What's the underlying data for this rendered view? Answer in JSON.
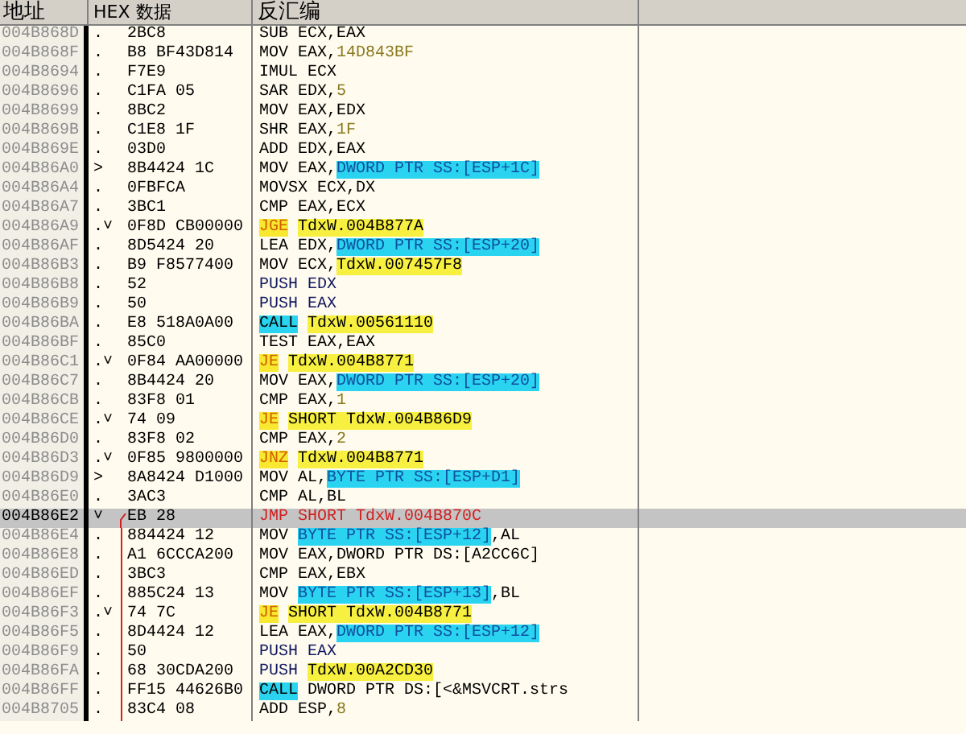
{
  "columns": {
    "address": "地址",
    "hex": "HEX 数据",
    "disassembly": "反汇编"
  },
  "rows": [
    {
      "address": "004B868D",
      "marker": ".",
      "hex": "2BC8",
      "segments": [
        {
          "text": "SUB ECX,EAX",
          "kind": "plain"
        }
      ],
      "selected": false,
      "jump_line": false
    },
    {
      "address": "004B868F",
      "marker": ".",
      "hex": "B8 BF43D814",
      "segments": [
        {
          "text": "MOV EAX,",
          "kind": "plain"
        },
        {
          "text": "14D843BF",
          "kind": "number"
        }
      ],
      "selected": false,
      "jump_line": false
    },
    {
      "address": "004B8694",
      "marker": ".",
      "hex": "F7E9",
      "segments": [
        {
          "text": "IMUL ECX",
          "kind": "plain"
        }
      ],
      "selected": false,
      "jump_line": false
    },
    {
      "address": "004B8696",
      "marker": ".",
      "hex": "C1FA 05",
      "segments": [
        {
          "text": "SAR EDX,",
          "kind": "plain"
        },
        {
          "text": "5",
          "kind": "number"
        }
      ],
      "selected": false,
      "jump_line": false
    },
    {
      "address": "004B8699",
      "marker": ".",
      "hex": "8BC2",
      "segments": [
        {
          "text": "MOV EAX,EDX",
          "kind": "plain"
        }
      ],
      "selected": false,
      "jump_line": false
    },
    {
      "address": "004B869B",
      "marker": ".",
      "hex": "C1E8 1F",
      "segments": [
        {
          "text": "SHR EAX,",
          "kind": "plain"
        },
        {
          "text": "1F",
          "kind": "number"
        }
      ],
      "selected": false,
      "jump_line": false
    },
    {
      "address": "004B869E",
      "marker": ".",
      "hex": "03D0",
      "segments": [
        {
          "text": "ADD EDX,EAX",
          "kind": "plain"
        }
      ],
      "selected": false,
      "jump_line": false
    },
    {
      "address": "004B86A0",
      "marker": ">",
      "hex": "8B4424 1C",
      "segments": [
        {
          "text": "MOV EAX,",
          "kind": "plain"
        },
        {
          "text": "DWORD PTR SS:[ESP+1C]",
          "kind": "memory"
        }
      ],
      "selected": false,
      "jump_line": false
    },
    {
      "address": "004B86A4",
      "marker": ".",
      "hex": "0FBFCA",
      "segments": [
        {
          "text": "MOVSX ECX,DX",
          "kind": "plain"
        }
      ],
      "selected": false,
      "jump_line": false
    },
    {
      "address": "004B86A7",
      "marker": ".",
      "hex": "3BC1",
      "segments": [
        {
          "text": "CMP EAX,ECX",
          "kind": "plain"
        }
      ],
      "selected": false,
      "jump_line": false
    },
    {
      "address": "004B86A9",
      "marker": ".˅",
      "hex": "0F8D CB00000",
      "segments": [
        {
          "text": "JGE",
          "kind": "cond_jump"
        },
        {
          "text": "TdxW.004B877A",
          "kind": "target"
        }
      ],
      "selected": false,
      "jump_line": false
    },
    {
      "address": "004B86AF",
      "marker": ".",
      "hex": "8D5424 20",
      "segments": [
        {
          "text": "LEA EDX,",
          "kind": "plain"
        },
        {
          "text": "DWORD PTR SS:[ESP+20]",
          "kind": "memory"
        }
      ],
      "selected": false,
      "jump_line": false
    },
    {
      "address": "004B86B3",
      "marker": ".",
      "hex": "B9 F8577400",
      "segments": [
        {
          "text": "MOV ECX,",
          "kind": "plain"
        },
        {
          "text": "TdxW.007457F8",
          "kind": "target"
        }
      ],
      "selected": false,
      "jump_line": false
    },
    {
      "address": "004B86B8",
      "marker": ".",
      "hex": "52",
      "segments": [
        {
          "text": "PUSH EDX",
          "kind": "stack"
        }
      ],
      "selected": false,
      "jump_line": false
    },
    {
      "address": "004B86B9",
      "marker": ".",
      "hex": "50",
      "segments": [
        {
          "text": "PUSH EAX",
          "kind": "stack"
        }
      ],
      "selected": false,
      "jump_line": false
    },
    {
      "address": "004B86BA",
      "marker": ".",
      "hex": "E8 518A0A00",
      "segments": [
        {
          "text": "CALL",
          "kind": "call"
        },
        {
          "text": "TdxW.00561110",
          "kind": "target"
        }
      ],
      "selected": false,
      "jump_line": false
    },
    {
      "address": "004B86BF",
      "marker": ".",
      "hex": "85C0",
      "segments": [
        {
          "text": "TEST EAX,EAX",
          "kind": "plain"
        }
      ],
      "selected": false,
      "jump_line": false
    },
    {
      "address": "004B86C1",
      "marker": ".˅",
      "hex": "0F84 AA00000",
      "segments": [
        {
          "text": "JE",
          "kind": "cond_jump"
        },
        {
          "text": "TdxW.004B8771",
          "kind": "target"
        }
      ],
      "selected": false,
      "jump_line": false
    },
    {
      "address": "004B86C7",
      "marker": ".",
      "hex": "8B4424 20",
      "segments": [
        {
          "text": "MOV EAX,",
          "kind": "plain"
        },
        {
          "text": "DWORD PTR SS:[ESP+20]",
          "kind": "memory"
        }
      ],
      "selected": false,
      "jump_line": false
    },
    {
      "address": "004B86CB",
      "marker": ".",
      "hex": "83F8 01",
      "segments": [
        {
          "text": "CMP EAX,",
          "kind": "plain"
        },
        {
          "text": "1",
          "kind": "number"
        }
      ],
      "selected": false,
      "jump_line": false
    },
    {
      "address": "004B86CE",
      "marker": ".˅",
      "hex": "74 09",
      "segments": [
        {
          "text": "JE",
          "kind": "cond_jump"
        },
        {
          "text": "SHORT TdxW.004B86D9",
          "kind": "target"
        }
      ],
      "selected": false,
      "jump_line": false
    },
    {
      "address": "004B86D0",
      "marker": ".",
      "hex": "83F8 02",
      "segments": [
        {
          "text": "CMP EAX,",
          "kind": "plain"
        },
        {
          "text": "2",
          "kind": "number"
        }
      ],
      "selected": false,
      "jump_line": false
    },
    {
      "address": "004B86D3",
      "marker": ".˅",
      "hex": "0F85 9800000",
      "segments": [
        {
          "text": "JNZ",
          "kind": "cond_jump"
        },
        {
          "text": "TdxW.004B8771",
          "kind": "target"
        }
      ],
      "selected": false,
      "jump_line": false
    },
    {
      "address": "004B86D9",
      "marker": ">",
      "hex": "8A8424 D1000",
      "segments": [
        {
          "text": "MOV AL,",
          "kind": "plain"
        },
        {
          "text": "BYTE PTR SS:[ESP+D1]",
          "kind": "memory"
        }
      ],
      "selected": false,
      "jump_line": false
    },
    {
      "address": "004B86E0",
      "marker": ".",
      "hex": "3AC3",
      "segments": [
        {
          "text": "CMP AL,BL",
          "kind": "plain"
        }
      ],
      "selected": false,
      "jump_line": false
    },
    {
      "address": "004B86E2",
      "marker": "˅",
      "hex": "EB 28",
      "segments": [
        {
          "text": "JMP SHORT TdxW.004B870C",
          "kind": "jump"
        }
      ],
      "selected": true,
      "jump_line": true
    },
    {
      "address": "004B86E4",
      "marker": ".",
      "hex": "884424 12",
      "segments": [
        {
          "text": "MOV ",
          "kind": "plain"
        },
        {
          "text": "BYTE PTR SS:[ESP+12]",
          "kind": "memory"
        },
        {
          "text": ",AL",
          "kind": "plain"
        }
      ],
      "selected": false,
      "jump_line": true
    },
    {
      "address": "004B86E8",
      "marker": ".",
      "hex": "A1 6CCCA200",
      "segments": [
        {
          "text": "MOV EAX,DWORD PTR DS:[A2CC6C]",
          "kind": "plain"
        }
      ],
      "selected": false,
      "jump_line": true
    },
    {
      "address": "004B86ED",
      "marker": ".",
      "hex": "3BC3",
      "segments": [
        {
          "text": "CMP EAX,EBX",
          "kind": "plain"
        }
      ],
      "selected": false,
      "jump_line": true
    },
    {
      "address": "004B86EF",
      "marker": ".",
      "hex": "885C24 13",
      "segments": [
        {
          "text": "MOV ",
          "kind": "plain"
        },
        {
          "text": "BYTE PTR SS:[ESP+13]",
          "kind": "memory"
        },
        {
          "text": ",BL",
          "kind": "plain"
        }
      ],
      "selected": false,
      "jump_line": true
    },
    {
      "address": "004B86F3",
      "marker": ".˅",
      "hex": "74 7C",
      "segments": [
        {
          "text": "JE",
          "kind": "cond_jump"
        },
        {
          "text": "SHORT TdxW.004B8771",
          "kind": "target"
        }
      ],
      "selected": false,
      "jump_line": true
    },
    {
      "address": "004B86F5",
      "marker": ".",
      "hex": "8D4424 12",
      "segments": [
        {
          "text": "LEA EAX,",
          "kind": "plain"
        },
        {
          "text": "DWORD PTR SS:[ESP+12]",
          "kind": "memory"
        }
      ],
      "selected": false,
      "jump_line": true
    },
    {
      "address": "004B86F9",
      "marker": ".",
      "hex": "50",
      "segments": [
        {
          "text": "PUSH EAX",
          "kind": "stack"
        }
      ],
      "selected": false,
      "jump_line": true
    },
    {
      "address": "004B86FA",
      "marker": ".",
      "hex": "68 30CDA200",
      "segments": [
        {
          "text": "PUSH ",
          "kind": "stack"
        },
        {
          "text": "TdxW.00A2CD30",
          "kind": "target"
        }
      ],
      "selected": false,
      "jump_line": true
    },
    {
      "address": "004B86FF",
      "marker": ".",
      "hex": "FF15 44626B0",
      "segments": [
        {
          "text": "CALL",
          "kind": "call"
        },
        {
          "text": "DWORD PTR DS:[<&MSVCRT.strs",
          "kind": "plain"
        }
      ],
      "selected": false,
      "jump_line": true
    },
    {
      "address": "004B8705",
      "marker": ".",
      "hex": "83C4 08",
      "segments": [
        {
          "text": "ADD ESP,",
          "kind": "plain"
        },
        {
          "text": "8",
          "kind": "number"
        }
      ],
      "selected": false,
      "jump_line": true
    }
  ]
}
